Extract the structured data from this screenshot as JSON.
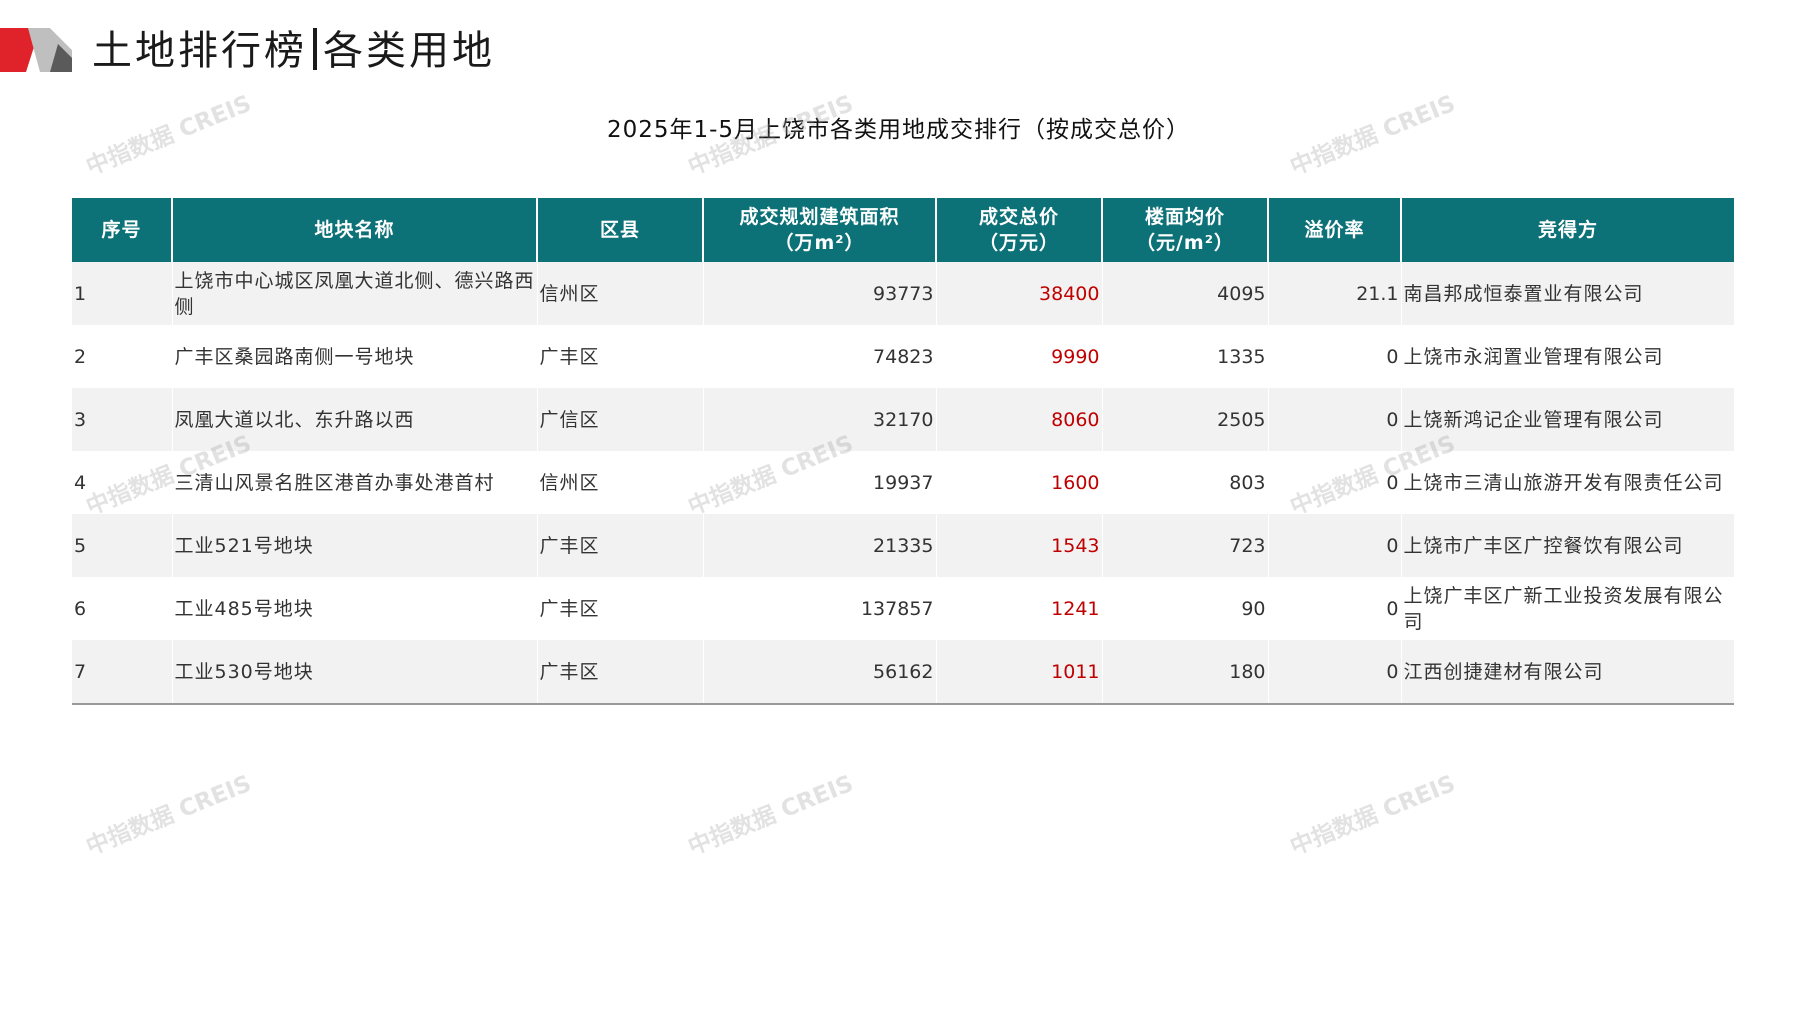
{
  "header": {
    "title_left": "土地排行榜",
    "title_right": "各类用地"
  },
  "table_title": "2025年1-5月上饶市各类用地成交排行（按成交总价）",
  "watermark": "中指数据 CREIS",
  "colors": {
    "header_bg": "#0d7178",
    "accent_red": "#c00000",
    "logo_red": "#e0232a",
    "logo_gray": "#bfbfbf"
  },
  "columns": [
    "序号",
    "地块名称",
    "区县",
    "成交规划建筑面积（万m²）",
    "成交总价（万元）",
    "楼面均价（元/m²）",
    "溢价率",
    "竞得方"
  ],
  "columns_display": [
    {
      "line1": "序号",
      "line2": ""
    },
    {
      "line1": "地块名称",
      "line2": ""
    },
    {
      "line1": "区县",
      "line2": ""
    },
    {
      "line1": "成交规划建筑面积",
      "line2": "（万m²）"
    },
    {
      "line1": "成交总价",
      "line2": "（万元）"
    },
    {
      "line1": "楼面均价",
      "line2": "（元/m²）"
    },
    {
      "line1": "溢价率",
      "line2": ""
    },
    {
      "line1": "竞得方",
      "line2": ""
    }
  ],
  "rows": [
    {
      "rank": "1",
      "name": "上饶市中心城区凤凰大道北侧、德兴路西侧",
      "district": "信州区",
      "area": "93773",
      "total": "38400",
      "avg": "4095",
      "premium": "21.1",
      "buyer": "南昌邦成恒泰置业有限公司"
    },
    {
      "rank": "2",
      "name": "广丰区桑园路南侧一号地块",
      "district": "广丰区",
      "area": "74823",
      "total": "9990",
      "avg": "1335",
      "premium": "0",
      "buyer": "上饶市永润置业管理有限公司"
    },
    {
      "rank": "3",
      "name": "凤凰大道以北、东升路以西",
      "district": "广信区",
      "area": "32170",
      "total": "8060",
      "avg": "2505",
      "premium": "0",
      "buyer": "上饶新鸿记企业管理有限公司"
    },
    {
      "rank": "4",
      "name": "三清山风景名胜区港首办事处港首村",
      "district": "信州区",
      "area": "19937",
      "total": "1600",
      "avg": "803",
      "premium": "0",
      "buyer": "上饶市三清山旅游开发有限责任公司"
    },
    {
      "rank": "5",
      "name": "工业521号地块",
      "district": "广丰区",
      "area": "21335",
      "total": "1543",
      "avg": "723",
      "premium": "0",
      "buyer": "上饶市广丰区广控餐饮有限公司"
    },
    {
      "rank": "6",
      "name": "工业485号地块",
      "district": "广丰区",
      "area": "137857",
      "total": "1241",
      "avg": "90",
      "premium": "0",
      "buyer": "上饶广丰区广新工业投资发展有限公司"
    },
    {
      "rank": "7",
      "name": "工业530号地块",
      "district": "广丰区",
      "area": "56162",
      "total": "1011",
      "avg": "180",
      "premium": "0",
      "buyer": "江西创捷建材有限公司"
    }
  ]
}
